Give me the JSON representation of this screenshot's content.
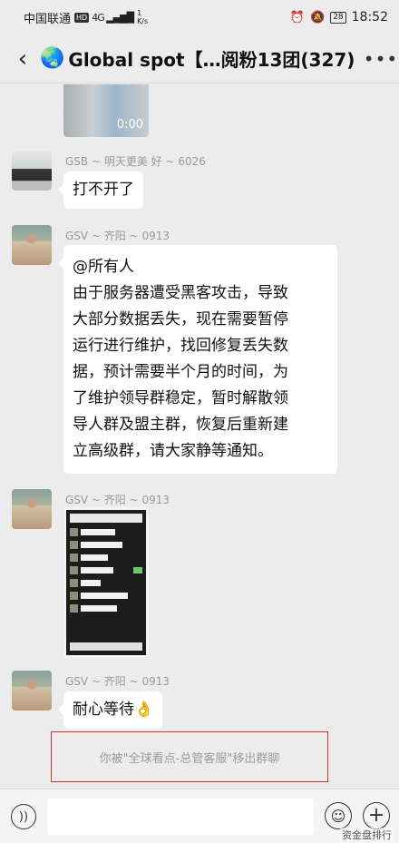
{
  "status_bar": {
    "carrier": "中国联通",
    "network": "HD",
    "signal": "4G",
    "speed_value": "1",
    "speed_unit": "K/s",
    "battery": "28",
    "time": "18:52"
  },
  "header": {
    "back_icon": "back-chevron-icon",
    "group_icon": "globe-icon",
    "title": "Global spot【…阅粉13团(327)",
    "more_icon": "more-dots-icon"
  },
  "messages": {
    "top_video": {
      "duration": "0:00"
    },
    "m1": {
      "sender": "GSB ~ 明天更美 好 ~ 6026",
      "text": "打不开了"
    },
    "m2": {
      "sender": "GSV ~ 齐阳 ~ 0913",
      "lines": [
        "@所有人",
        "由于服务器遭受黑客攻击，导致",
        "大部分数据丢失，现在需要暂停",
        "运行进行维护，找回修复丢失数",
        "据，预计需要半个月的时间，为",
        "了维护领导群稳定，暂时解散领",
        "导人群及盟主群，恢复后重新建",
        "立高级群，请大家静等通知。"
      ]
    },
    "m3": {
      "sender": "GSV ~ 齐阳 ~ 0913"
    },
    "m4": {
      "sender": "GSV ~ 齐阳 ~ 0913",
      "text": "耐心等待👌"
    }
  },
  "system_notice": "你被\"全球看点-总管客服\"移出群聊",
  "input_bar": {
    "voice_icon": "voice-icon",
    "emoji_icon": "emoji-icon",
    "plus_icon": "plus-icon"
  },
  "watermark": "资金盘排行"
}
